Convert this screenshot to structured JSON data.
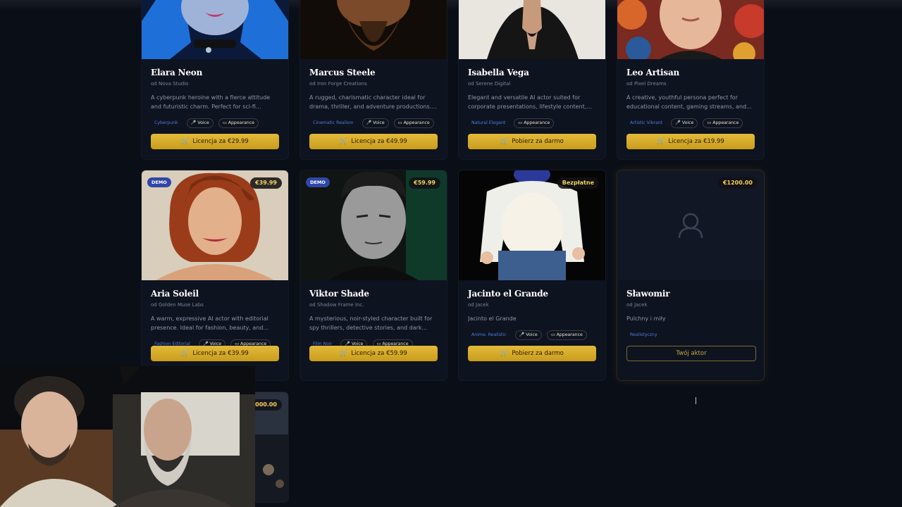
{
  "cards_top": [
    {
      "name": "Elara Neon",
      "by": "od Nova Studio",
      "desc": "A cyberpunk heroine with a fierce attitude and futuristic charm. Perfect for sci-fi...",
      "tags": [
        "Cyberpunk",
        "🎤 Voice",
        "▭ Appearance"
      ],
      "button": "Licencja za €29.99"
    },
    {
      "name": "Marcus Steele",
      "by": "od Iron Forge Creations",
      "desc": "A rugged, charismatic character ideal for drama, thriller, and adventure productions....",
      "tags": [
        "Cinematic Realism",
        "🎤 Voice",
        "▭ Appearance"
      ],
      "button": "Licencja za €49.99"
    },
    {
      "name": "Isabella Vega",
      "by": "od Serene Digital",
      "desc": "Elegant and versatile AI actor suited for corporate presentations, lifestyle content,...",
      "tags": [
        "Natural Elegant",
        "▭ Appearance"
      ],
      "button": "Pobierz za darmo"
    },
    {
      "name": "Leo Artisan",
      "by": "od Pixel Dreams",
      "desc": "A creative, youthful persona perfect for educational content, gaming streams, and...",
      "tags": [
        "Artistic Vibrant",
        "🎤 Voice",
        "▭ Appearance"
      ],
      "button": "Licencja za €19.99"
    }
  ],
  "cards_mid": [
    {
      "name": "Aria Soleil",
      "by": "od Golden Muse Labs",
      "desc": "A warm, expressive AI actor with editorial presence. Ideal for fashion, beauty, and...",
      "tags": [
        "Fashion Editorial",
        "🎤 Voice",
        "▭ Appearance"
      ],
      "button": "Licencja za €39.99",
      "price": "€39.99",
      "badge": "DEMO"
    },
    {
      "name": "Viktor Shade",
      "by": "od Shadow Frame Inc.",
      "desc": "A mysterious, noir-styled character built for spy thrillers, detective stories, and dark...",
      "tags": [
        "Film Noir",
        "🎤 Voice",
        "▭ Appearance"
      ],
      "button": "Licencja za €59.99",
      "price": "€59.99",
      "badge": "DEMO"
    },
    {
      "name": "Jacinto el Grande",
      "by": "od Jacek",
      "desc": "Jacinto el Grande",
      "tags": [
        "Anime, Realistic",
        "🎤 Voice",
        "▭ Appearance"
      ],
      "button": "Pobierz za darmo",
      "price": "Bezpłatne"
    },
    {
      "name": "Sławomir",
      "by": "od Jacek",
      "desc": "Pulchny i miły",
      "tags": [
        "Realistyczny"
      ],
      "button": "Twój aktor",
      "price": "€1200.00"
    }
  ],
  "card_bottom": {
    "price": "€1...0000.00"
  },
  "colors": {
    "accent": "#d4aa2e",
    "demo": "#2f47a8",
    "bg": "#0a0e17"
  }
}
